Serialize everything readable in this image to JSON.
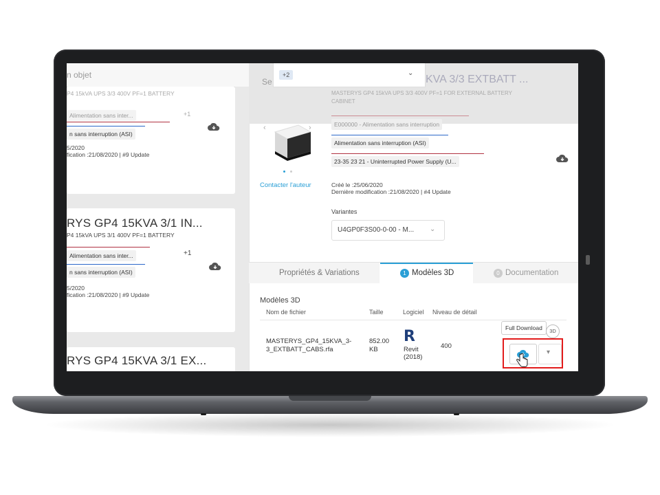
{
  "search": {
    "placeholder": "n objet"
  },
  "filter": {
    "chip": "+2",
    "search_hint": "Se"
  },
  "left_cards": [
    {
      "subtitle": "P4 15kVA UPS 3/3 400V PF=1 BATTERY",
      "tag1": "Alimentation sans inter...",
      "tag1_count": "+1",
      "tag2": "n sans interruption (ASI)",
      "date": "5/2020",
      "modif": "fication :21/08/2020 | #9 Update"
    },
    {
      "title": "RYS GP4 15KVA 3/1 IN...",
      "subtitle": "P4 15kVA UPS 3/1 400V PF=1 BATTERY",
      "tag1": "Alimentation sans inter...",
      "tag1_count": "+1",
      "tag2": "n sans interruption (ASI)",
      "date": "5/2020",
      "modif": "fication :21/08/2020 | #9 Update"
    },
    {
      "title": "RYS GP4 15KVA 3/1 EX..."
    }
  ],
  "detail": {
    "title_partial": "KVA 3/3 EXTBATT ...",
    "subtitle": "MASTERYS GP4 15kVA UPS 3/3 400V PF=1 FOR EXTERNAL BATTERY CABINET",
    "code_tag": "E000000 - Alimentation sans interruption",
    "tag_asi": "Alimentation sans interruption (ASI)",
    "tag_uniclass": "23-35 23 21 - Uninterrupted Power Supply (U...",
    "contact": "Contacter l'auteur",
    "created": "Créé le :25/06/2020",
    "modified": "Dernière modification :21/08/2020 | #4 Update",
    "variants_label": "Variantes",
    "variant_value": "U4GP0F3S00-0-00 - M..."
  },
  "tabs": [
    {
      "label": "Propriétés & Variations",
      "badge": ""
    },
    {
      "label": "Modèles 3D",
      "badge": "1"
    },
    {
      "label": "Documentation",
      "badge": "0"
    }
  ],
  "models": {
    "heading": "Modèles 3D",
    "columns": [
      "Nom de fichier",
      "Taille",
      "Logiciel",
      "Niveau de détail"
    ],
    "row": {
      "filename": "MASTERYS_GP4_15KVA_3-3_EXTBATT_CABS.rfa",
      "size": "852.00 KB",
      "software": "Revit (2018)",
      "software_letter": "R",
      "lod": "400"
    },
    "tooltip": "Full Download",
    "badge_3d": "3D"
  },
  "colors": {
    "accent_blue": "#2a9fd6",
    "highlight_red": "#e21b1b",
    "tag_red": "#b03040",
    "tag_blue": "#2a67c9"
  }
}
